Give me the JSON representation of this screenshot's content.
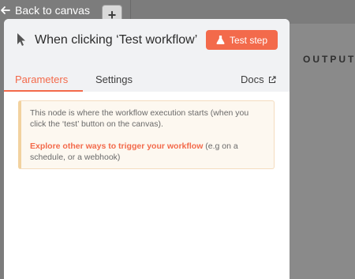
{
  "topbar": {
    "back_label": "Back to canvas",
    "add_label": "+"
  },
  "output": {
    "label": "OUTPUT"
  },
  "node": {
    "title": "When clicking ‘Test workflow’",
    "icon": "cursor-icon",
    "test_button_label": "Test step"
  },
  "tabs": {
    "parameters": "Parameters",
    "settings": "Settings",
    "docs": "Docs"
  },
  "notice": {
    "line1": "This node is where the workflow execution starts (when you click the ‘test’ button on the canvas).",
    "link": "Explore other ways to trigger your workflow",
    "line2_rest": " (e.g on a schedule, or a webhook)"
  },
  "colors": {
    "accent": "#f36a4b",
    "notice_bg": "#fdf8f0",
    "notice_border": "#f2d29f"
  }
}
